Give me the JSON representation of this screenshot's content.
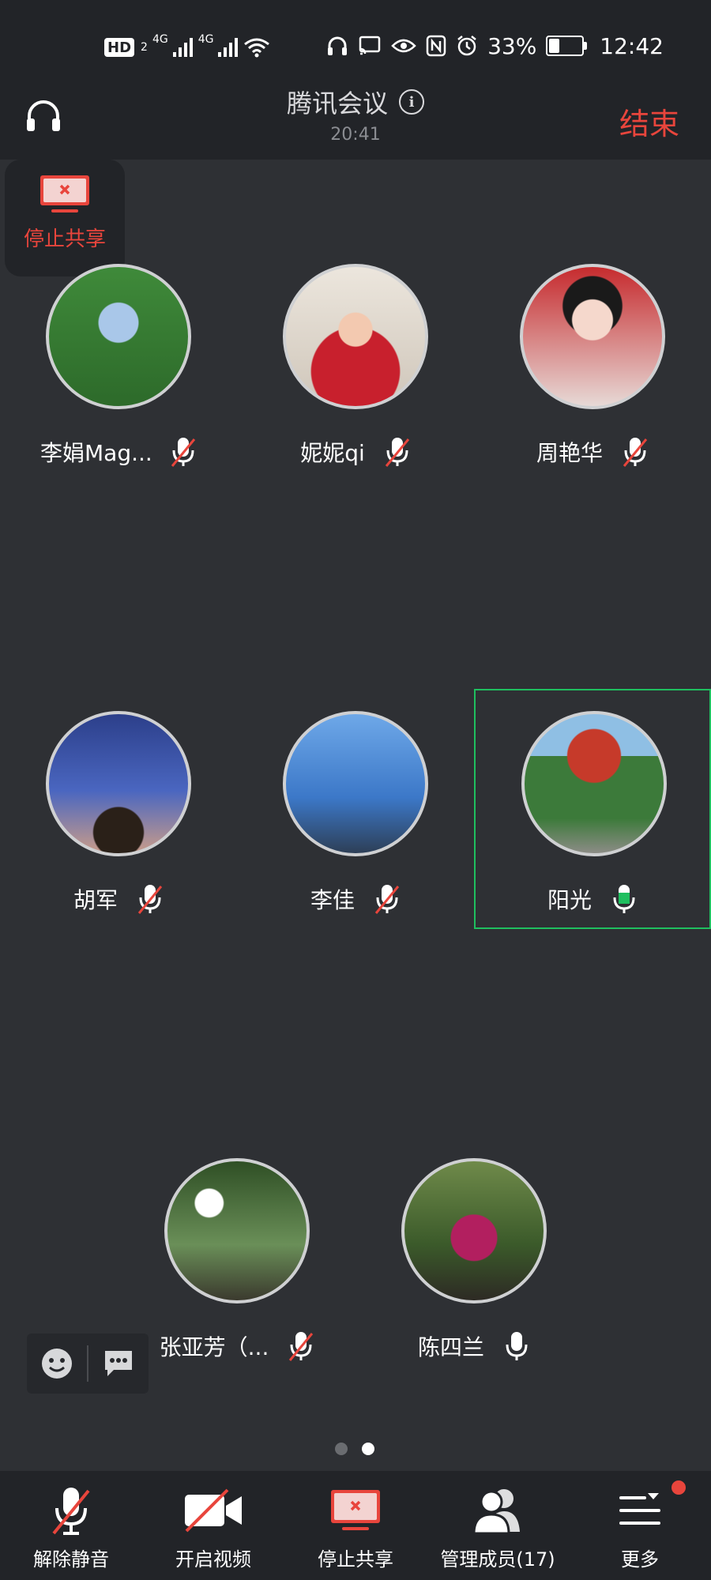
{
  "status_bar": {
    "hd_label": "HD",
    "hd_sub": "2",
    "network1": "4G",
    "network2": "4G",
    "battery_percent": "33%",
    "battery_level": 0.33,
    "time": "12:42"
  },
  "header": {
    "title": "腾讯会议",
    "timer": "20:41",
    "end_label": "结束"
  },
  "share_float": {
    "label": "停止共享"
  },
  "participants": [
    {
      "name": "李娟Mag...",
      "mic": "muted"
    },
    {
      "name": "妮妮qi",
      "mic": "muted"
    },
    {
      "name": "周艳华",
      "mic": "muted"
    },
    {
      "name": "胡军",
      "mic": "muted"
    },
    {
      "name": "李佳",
      "mic": "muted"
    },
    {
      "name": "阳光",
      "mic": "speaking"
    },
    {
      "name": "张亚芳（...",
      "mic": "muted"
    },
    {
      "name": "陈四兰",
      "mic": "on"
    }
  ],
  "pager": {
    "pages": 2,
    "current": 2
  },
  "toolbar": {
    "unmute_label": "解除静音",
    "video_label": "开启视频",
    "stop_share_label": "停止共享",
    "members_label": "管理成员(17)",
    "more_label": "更多"
  },
  "colors": {
    "accent_red": "#e8453c",
    "speaking_green": "#1fbf5f",
    "background": "#2e3034",
    "bar": "#222428"
  }
}
